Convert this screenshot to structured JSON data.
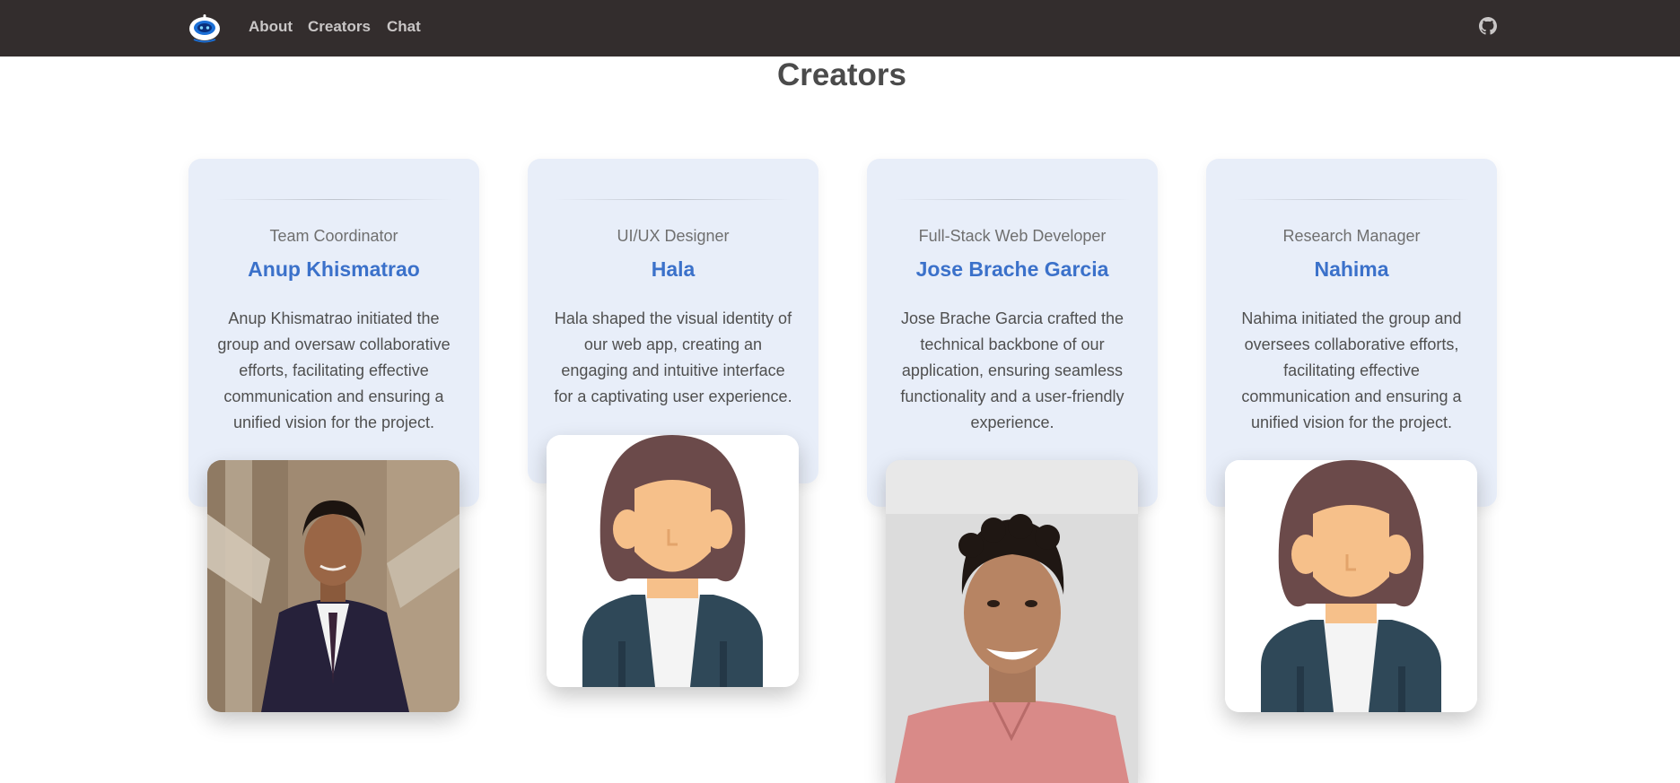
{
  "nav": {
    "logo_icon": "robot-logo-icon",
    "links": [
      "About",
      "Creators",
      "Chat"
    ],
    "github_icon": "github-icon"
  },
  "page": {
    "title": "Creators"
  },
  "creators": [
    {
      "role": "Team Coordinator",
      "name": "Anup Khismatrao",
      "bio": "Anup Khismatrao initiated the group and oversaw collaborative efforts, facilitating effective communication and ensuring a unified vision for the project.",
      "photo": "portrait-photo"
    },
    {
      "role": "UI/UX Designer",
      "name": "Hala",
      "bio": "Hala shaped the visual identity of our web app, creating an engaging and intuitive interface for a captivating user experience.",
      "photo": "female-avatar-icon"
    },
    {
      "role": "Full-Stack Web Developer",
      "name": "Jose Brache Garcia",
      "bio": "Jose Brache Garcia crafted the technical backbone of our application, ensuring seamless functionality and a user-friendly experience.",
      "photo": "portrait-photo"
    },
    {
      "role": "Research Manager",
      "name": "Nahima",
      "bio": "Nahima initiated the group and oversees collaborative efforts, facilitating effective communication and ensuring a unified vision for the project.",
      "photo": "female-avatar-icon"
    }
  ],
  "colors": {
    "navbar": "#332d2d",
    "card": "#e8eef9",
    "accent": "#3b71ca"
  }
}
